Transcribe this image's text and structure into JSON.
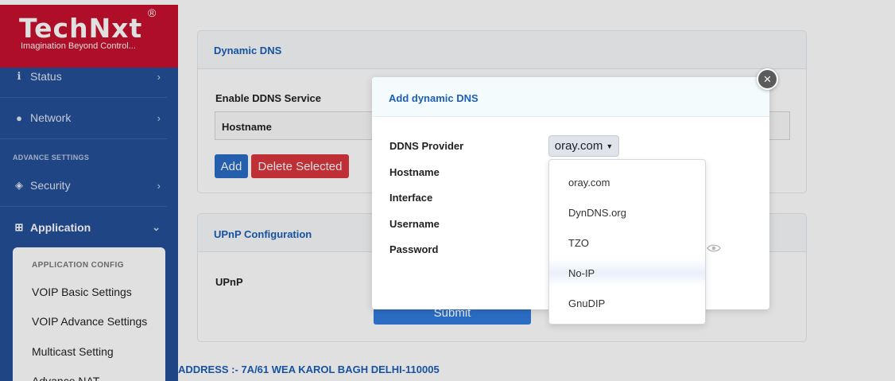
{
  "brand": {
    "name": "TechNxt",
    "registered": "®",
    "tagline": "Imagination Beyond Control..."
  },
  "sidebar": {
    "items": [
      {
        "label": "Status"
      },
      {
        "label": "Network"
      }
    ],
    "advance_settings_label": "ADVANCE SETTINGS",
    "security": {
      "label": "Security"
    },
    "application": {
      "label": "Application"
    },
    "app_config_label": "APPLICATION CONFIG",
    "sub_items": [
      "VOIP Basic Settings",
      "VOIP Advance Settings",
      "Multicast Setting",
      "Advance NAT"
    ]
  },
  "ddns_card": {
    "title": "Dynamic DNS",
    "enable_label": "Enable DDNS Service",
    "table_header_hostname": "Hostname",
    "add_button": "Add",
    "delete_button": "Delete Selected"
  },
  "upnp_card": {
    "title": "UPnP Configuration",
    "upnp_label": "UPnP",
    "submit_button": "Submit"
  },
  "footer": {
    "address": "ADDRESS :- 7A/61 WEA KAROL BAGH DELHI-110005"
  },
  "modal": {
    "title": "Add dynamic DNS",
    "close": "×",
    "labels": {
      "provider": "DDNS Provider",
      "hostname": "Hostname",
      "interface": "Interface",
      "username": "Username",
      "password": "Password"
    },
    "provider_selected": "oray.com",
    "provider_options": [
      "oray.com",
      "DynDNS.org",
      "TZO",
      "No-IP",
      "GnuDIP"
    ],
    "hovered_option": "No-IP"
  },
  "icons": {
    "status": "info-icon",
    "network": "globe-icon",
    "security": "shield-icon",
    "application": "sitemap-icon",
    "chevron": "chevron-right-icon",
    "password_toggle": "eye-icon"
  },
  "colors": {
    "sidebar_bg": "#254f97",
    "brand_red": "#c8102e",
    "accent_blue": "#1b5eb8",
    "danger": "#d9363e"
  }
}
